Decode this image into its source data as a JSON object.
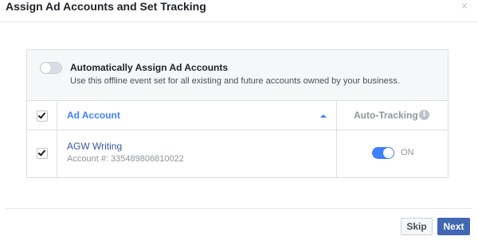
{
  "dialog": {
    "title": "Assign Ad Accounts and Set Tracking",
    "close_symbol": "×"
  },
  "auto_assign": {
    "title": "Automatically Assign Ad Accounts",
    "description": "Use this offline event set for all existing and future accounts owned by your business.",
    "enabled": false
  },
  "table": {
    "header_checked": true,
    "columns": {
      "account": "Ad Account",
      "tracking": "Auto-Tracking",
      "info_symbol": "i"
    },
    "sort": "ascending",
    "rows": [
      {
        "checked": true,
        "name": "AGW Writing",
        "account_id": "Account #: 335489806810022",
        "tracking_enabled": true,
        "tracking_label": "ON"
      }
    ]
  },
  "footer": {
    "skip_label": "Skip",
    "next_label": "Next"
  },
  "colors": {
    "accent": "#4080ff",
    "primary_button": "#4267b2",
    "link": "#365899"
  },
  "icons": [
    "close-icon",
    "checkbox-check-icon",
    "sort-arrow-up-icon",
    "info-icon"
  ]
}
